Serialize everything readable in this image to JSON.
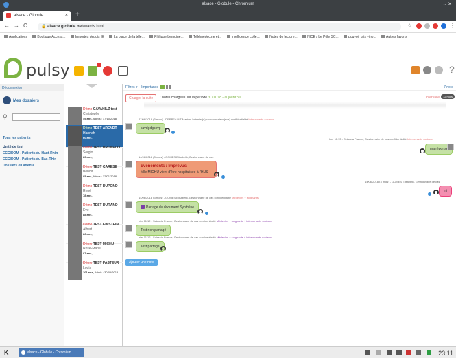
{
  "browser": {
    "window_title": "alsace - Globule - Chromium",
    "tab_title": "alsace - Globule",
    "url_host": "alsace.globule.net",
    "url_path": "/wards.html",
    "bookmarks": [
      "Applications",
      "Boutique Access...",
      "Importés depuis IE",
      "La place de la télé...",
      "Philippe Lemoine...",
      "Télémédecine et...",
      "Intelligence colle...",
      "Notes de lecture...",
      "NICE / Le Pôle SC...",
      "pouvoir gris vino...",
      "Autres favoris"
    ]
  },
  "app": {
    "logo_text": "pulsy"
  },
  "sidebar": {
    "logout": "Déconnexion",
    "my_folders": "Mes dossiers",
    "all_patients": "Tous les patients",
    "links": [
      "Unité de test",
      "ECCIDOM - Patients du Haut-Rhin",
      "ECCIDOM - Patients du Bas-Rhin",
      "Dossiers en attente"
    ]
  },
  "patients": [
    {
      "demo": "Démo",
      "last": "CAVAHILZ test",
      "first": "Christophe",
      "age": "49 ans,",
      "extra": "Admis : 17/10/2018"
    },
    {
      "demo": "Démo",
      "last": "TEST ARENDT",
      "first": "Hannah",
      "age": "60 ans,",
      "extra": "",
      "active": true
    },
    {
      "demo": "Démo",
      "last": "TEST BRUNELLI",
      "first": "Sergio",
      "age": "80 ans,",
      "extra": ""
    },
    {
      "demo": "Démo",
      "last": "TEST CARESE",
      "first": "Benoît",
      "age": "85 ans,",
      "extra": "Admis : 12/01/2018"
    },
    {
      "demo": "Démo",
      "last": "TEST DUPOND",
      "first": "René",
      "age": "78 ans,",
      "extra": ""
    },
    {
      "demo": "Démo",
      "last": "TEST DURAND",
      "first": "Eve",
      "age": "88 ans,",
      "extra": ""
    },
    {
      "demo": "Démo",
      "last": "TEST EINSTEIN",
      "first": "Albert",
      "age": "86 ans,",
      "extra": ""
    },
    {
      "demo": "Démo",
      "last": "TEST MICHU",
      "first": "Rose-Marie",
      "age": "87 ans,",
      "extra": ""
    },
    {
      "demo": "Démo",
      "last": "TEST PASTEUR",
      "first": "Louis",
      "age": "101 ans,",
      "extra": "Admis : 30/05/2018"
    }
  ],
  "main": {
    "filters_label": "Filtres",
    "importance_label": "Importance",
    "right_label": "7 note",
    "load_more": "Charger la suite",
    "load_info_prefix": "7 notes chargées sur la période",
    "load_info_dates": "31/01/18 - aujourd'hui",
    "interval_label": "Intervalle",
    "interval_value": "12 mois",
    "add_note": "Ajouter une note",
    "messages": [
      {
        "meta": "27/06/2018 (3 mois) - DERPEAULT Marion, Infirmier(e) coordonnateur(rice) confidentialité",
        "meta_tag": "Intervenants sociaux",
        "text": "cavdgdgsovg"
      },
      {
        "meta": "hier 11:13 - Sciascia France, Gestionnaire de cas confidentialité",
        "meta_tag": "Intervenants sociaux",
        "text": "ma réponse"
      },
      {
        "meta": "14/06/2018 (3 mois) - GOMES Elisabeth, Gestionnaire de cas",
        "meta_tag": "",
        "title": "Evènements / Imprévus",
        "text": "Mlle MICHU vient d'être hospitalisée à l'HUS"
      },
      {
        "meta": "14/06/2018 (3 mois) - GOMES Elisabeth, Gestionnaire de cas",
        "meta_tag": "",
        "text": "Ini"
      },
      {
        "meta": "14/06/2018 (3 mois) - GOMES Elisabeth, Gestionnaire de cas confidentialité",
        "meta_tag": "Médecins + soignants",
        "text": "Partage du document Synthèse"
      },
      {
        "meta": "hier 11:12 - Sciascia France, Gestionnaire de cas confidentialité",
        "meta_tag": "Médecins + soignants + intervenants sociaux",
        "text": "Test non partagé"
      },
      {
        "meta": "hier 11:12 - Sciascia France, Gestionnaire de cas confidentialité",
        "meta_tag": "Médecins + soignants + intervenants sociaux",
        "text": "Test partagé"
      }
    ]
  },
  "taskbar": {
    "start": "K",
    "item": "alsace - Globule - Chromium",
    "clock": "23:11"
  }
}
